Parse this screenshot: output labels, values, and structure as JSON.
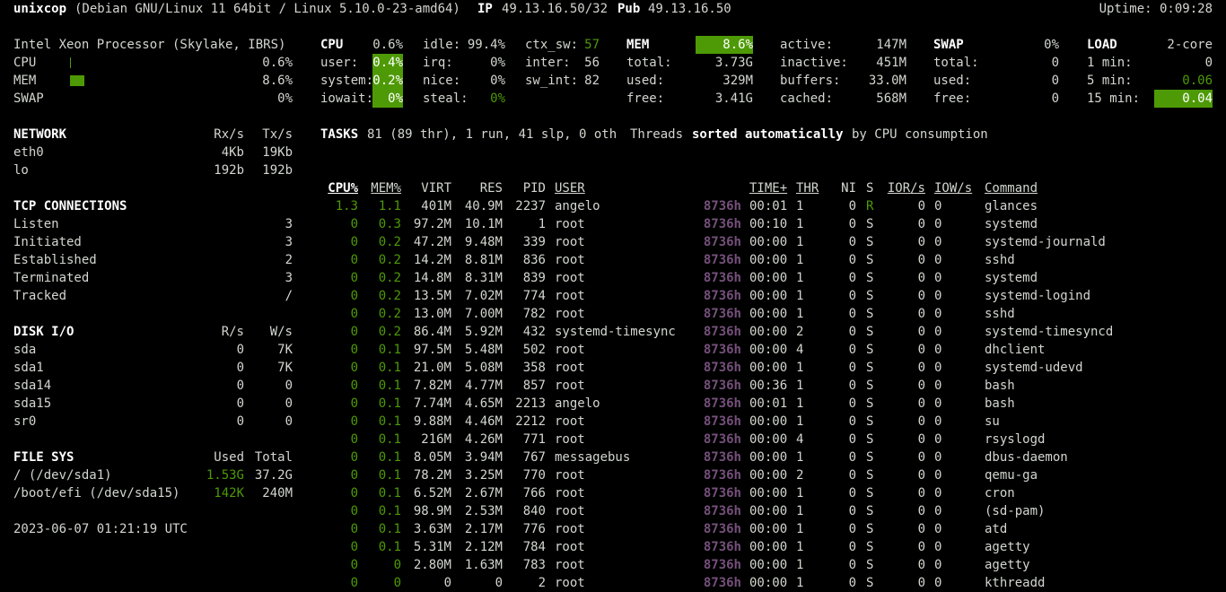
{
  "header": {
    "hostname": "unixcop",
    "os": "(Debian GNU/Linux 11 64bit / Linux 5.10.0-23-amd64)",
    "ip_label": "IP",
    "ip_value": "49.13.16.50/32",
    "pub_label": "Pub",
    "pub_value": "49.13.16.50",
    "uptime": "Uptime: 0:09:28"
  },
  "quicklook": {
    "cpu_name": "Intel Xeon Processor (Skylake, IBRS)",
    "rows": [
      {
        "label": "CPU",
        "value": "0.6%",
        "fraction": 0.006
      },
      {
        "label": "MEM",
        "value": "8.6%",
        "fraction": 0.086
      },
      {
        "label": "SWAP",
        "value": "0%",
        "fraction": 0
      }
    ]
  },
  "cpu": {
    "title": "CPU",
    "total": "0.6%",
    "col1": [
      {
        "l": "user:",
        "v": "0.4%"
      },
      {
        "l": "system:",
        "v": "0.2%"
      },
      {
        "l": "iowait:",
        "v": "0%"
      }
    ],
    "col2": [
      {
        "l": "idle:",
        "v": "99.4%"
      },
      {
        "l": "irq:",
        "v": "0%"
      },
      {
        "l": "nice:",
        "v": "0%"
      },
      {
        "l": "steal:",
        "v": "0%"
      }
    ],
    "col3": [
      {
        "l": "ctx_sw:",
        "v": "57"
      },
      {
        "l": "inter:",
        "v": "56"
      },
      {
        "l": "sw_int:",
        "v": "82"
      }
    ]
  },
  "mem": {
    "title": "MEM",
    "total": "8.6%",
    "col1": [
      {
        "l": "total:",
        "v": "3.73G"
      },
      {
        "l": "used:",
        "v": "329M"
      },
      {
        "l": "free:",
        "v": "3.41G"
      }
    ],
    "col2": [
      {
        "l": "active:",
        "v": "147M"
      },
      {
        "l": "inactive:",
        "v": "451M"
      },
      {
        "l": "buffers:",
        "v": "33.0M"
      },
      {
        "l": "cached:",
        "v": "568M"
      }
    ]
  },
  "swap": {
    "title": "SWAP",
    "total": "0%",
    "rows": [
      {
        "l": "total:",
        "v": "0"
      },
      {
        "l": "used:",
        "v": "0"
      },
      {
        "l": "free:",
        "v": "0"
      }
    ]
  },
  "load": {
    "title": "LOAD",
    "cores": "2-core",
    "rows": [
      {
        "l": "1 min:",
        "v": "0"
      },
      {
        "l": "5 min:",
        "v": "0.06"
      },
      {
        "l": "15 min:",
        "v": "0.04"
      }
    ]
  },
  "network": {
    "title": "NETWORK",
    "rx": "Rx/s",
    "tx": "Tx/s",
    "rows": [
      {
        "name": "eth0",
        "rx": "4Kb",
        "tx": "19Kb"
      },
      {
        "name": "lo",
        "rx": "192b",
        "tx": "192b"
      }
    ]
  },
  "tcp": {
    "title": "TCP CONNECTIONS",
    "rows": [
      {
        "l": "Listen",
        "v": "3"
      },
      {
        "l": "Initiated",
        "v": "3"
      },
      {
        "l": "Established",
        "v": "2"
      },
      {
        "l": "Terminated",
        "v": "3"
      },
      {
        "l": "Tracked",
        "v": "/"
      }
    ]
  },
  "disk": {
    "title": "DISK I/O",
    "r": "R/s",
    "w": "W/s",
    "rows": [
      {
        "name": "sda",
        "r": "0",
        "w": "7K"
      },
      {
        "name": "sda1",
        "r": "0",
        "w": "7K"
      },
      {
        "name": "sda14",
        "r": "0",
        "w": "0"
      },
      {
        "name": "sda15",
        "r": "0",
        "w": "0"
      },
      {
        "name": "sr0",
        "r": "0",
        "w": "0"
      }
    ]
  },
  "fs": {
    "title": "FILE SYS",
    "used": "Used",
    "total": "Total",
    "rows": [
      {
        "name": "/ (/dev/sda1)",
        "used": "1.53G",
        "total": "37.2G"
      },
      {
        "name": "/boot/efi (/dev/sda15)",
        "used": "142K",
        "total": "240M"
      }
    ]
  },
  "datetime": "2023-06-07 01:21:19 UTC",
  "tasks": {
    "title": "TASKS",
    "summary": "81 (89 thr), 1 run, 41 slp, 0 oth",
    "threads": "Threads",
    "sorted": "sorted automatically",
    "by": "by CPU consumption"
  },
  "proc_headers": {
    "cpu": "CPU%",
    "mem": "MEM%",
    "virt": "VIRT",
    "res": "RES",
    "pid": "PID",
    "user": "USER",
    "time": "TIME+",
    "thr": "THR",
    "ni": "NI",
    "s": "S",
    "ior": "IOR/s",
    "iow": "IOW/s",
    "cmd": "Command"
  },
  "processes": [
    {
      "cpu": "1.3",
      "mem": "1.1",
      "virt": "401M",
      "res": "40.9M",
      "pid": "2237",
      "user": "angelo",
      "h": "8736h",
      "time": "00:01",
      "thr": "1",
      "ni": "0",
      "s": "R",
      "ior": "0",
      "iow": "0",
      "cmd": "glances"
    },
    {
      "cpu": "0",
      "mem": "0.3",
      "virt": "97.2M",
      "res": "10.1M",
      "pid": "1",
      "user": "root",
      "h": "8736h",
      "time": "00:10",
      "thr": "1",
      "ni": "0",
      "s": "S",
      "ior": "0",
      "iow": "0",
      "cmd": "systemd"
    },
    {
      "cpu": "0",
      "mem": "0.2",
      "virt": "47.2M",
      "res": "9.48M",
      "pid": "339",
      "user": "root",
      "h": "8736h",
      "time": "00:00",
      "thr": "1",
      "ni": "0",
      "s": "S",
      "ior": "0",
      "iow": "0",
      "cmd": "systemd-journald"
    },
    {
      "cpu": "0",
      "mem": "0.2",
      "virt": "14.2M",
      "res": "8.81M",
      "pid": "836",
      "user": "root",
      "h": "8736h",
      "time": "00:00",
      "thr": "1",
      "ni": "0",
      "s": "S",
      "ior": "0",
      "iow": "0",
      "cmd": "sshd"
    },
    {
      "cpu": "0",
      "mem": "0.2",
      "virt": "14.8M",
      "res": "8.31M",
      "pid": "839",
      "user": "root",
      "h": "8736h",
      "time": "00:00",
      "thr": "1",
      "ni": "0",
      "s": "S",
      "ior": "0",
      "iow": "0",
      "cmd": "systemd"
    },
    {
      "cpu": "0",
      "mem": "0.2",
      "virt": "13.5M",
      "res": "7.02M",
      "pid": "774",
      "user": "root",
      "h": "8736h",
      "time": "00:00",
      "thr": "1",
      "ni": "0",
      "s": "S",
      "ior": "0",
      "iow": "0",
      "cmd": "systemd-logind"
    },
    {
      "cpu": "0",
      "mem": "0.2",
      "virt": "13.0M",
      "res": "7.00M",
      "pid": "782",
      "user": "root",
      "h": "8736h",
      "time": "00:00",
      "thr": "1",
      "ni": "0",
      "s": "S",
      "ior": "0",
      "iow": "0",
      "cmd": "sshd"
    },
    {
      "cpu": "0",
      "mem": "0.2",
      "virt": "86.4M",
      "res": "5.92M",
      "pid": "432",
      "user": "systemd-timesync",
      "h": "8736h",
      "time": "00:00",
      "thr": "2",
      "ni": "0",
      "s": "S",
      "ior": "0",
      "iow": "0",
      "cmd": "systemd-timesyncd"
    },
    {
      "cpu": "0",
      "mem": "0.1",
      "virt": "97.5M",
      "res": "5.48M",
      "pid": "502",
      "user": "root",
      "h": "8736h",
      "time": "00:00",
      "thr": "4",
      "ni": "0",
      "s": "S",
      "ior": "0",
      "iow": "0",
      "cmd": "dhclient"
    },
    {
      "cpu": "0",
      "mem": "0.1",
      "virt": "21.0M",
      "res": "5.08M",
      "pid": "358",
      "user": "root",
      "h": "8736h",
      "time": "00:00",
      "thr": "1",
      "ni": "0",
      "s": "S",
      "ior": "0",
      "iow": "0",
      "cmd": "systemd-udevd"
    },
    {
      "cpu": "0",
      "mem": "0.1",
      "virt": "7.82M",
      "res": "4.77M",
      "pid": "857",
      "user": "root",
      "h": "8736h",
      "time": "00:36",
      "thr": "1",
      "ni": "0",
      "s": "S",
      "ior": "0",
      "iow": "0",
      "cmd": "bash"
    },
    {
      "cpu": "0",
      "mem": "0.1",
      "virt": "7.74M",
      "res": "4.65M",
      "pid": "2213",
      "user": "angelo",
      "h": "8736h",
      "time": "00:01",
      "thr": "1",
      "ni": "0",
      "s": "S",
      "ior": "0",
      "iow": "0",
      "cmd": "bash"
    },
    {
      "cpu": "0",
      "mem": "0.1",
      "virt": "9.88M",
      "res": "4.46M",
      "pid": "2212",
      "user": "root",
      "h": "8736h",
      "time": "00:00",
      "thr": "1",
      "ni": "0",
      "s": "S",
      "ior": "0",
      "iow": "0",
      "cmd": "su"
    },
    {
      "cpu": "0",
      "mem": "0.1",
      "virt": "216M",
      "res": "4.26M",
      "pid": "771",
      "user": "root",
      "h": "8736h",
      "time": "00:00",
      "thr": "4",
      "ni": "0",
      "s": "S",
      "ior": "0",
      "iow": "0",
      "cmd": "rsyslogd"
    },
    {
      "cpu": "0",
      "mem": "0.1",
      "virt": "8.05M",
      "res": "3.94M",
      "pid": "767",
      "user": "messagebus",
      "h": "8736h",
      "time": "00:00",
      "thr": "1",
      "ni": "0",
      "s": "S",
      "ior": "0",
      "iow": "0",
      "cmd": "dbus-daemon"
    },
    {
      "cpu": "0",
      "mem": "0.1",
      "virt": "78.2M",
      "res": "3.25M",
      "pid": "770",
      "user": "root",
      "h": "8736h",
      "time": "00:00",
      "thr": "2",
      "ni": "0",
      "s": "S",
      "ior": "0",
      "iow": "0",
      "cmd": "qemu-ga"
    },
    {
      "cpu": "0",
      "mem": "0.1",
      "virt": "6.52M",
      "res": "2.67M",
      "pid": "766",
      "user": "root",
      "h": "8736h",
      "time": "00:00",
      "thr": "1",
      "ni": "0",
      "s": "S",
      "ior": "0",
      "iow": "0",
      "cmd": "cron"
    },
    {
      "cpu": "0",
      "mem": "0.1",
      "virt": "98.9M",
      "res": "2.53M",
      "pid": "840",
      "user": "root",
      "h": "8736h",
      "time": "00:00",
      "thr": "1",
      "ni": "0",
      "s": "S",
      "ior": "0",
      "iow": "0",
      "cmd": "(sd-pam)"
    },
    {
      "cpu": "0",
      "mem": "0.1",
      "virt": "3.63M",
      "res": "2.17M",
      "pid": "776",
      "user": "root",
      "h": "8736h",
      "time": "00:00",
      "thr": "1",
      "ni": "0",
      "s": "S",
      "ior": "0",
      "iow": "0",
      "cmd": "atd"
    },
    {
      "cpu": "0",
      "mem": "0.1",
      "virt": "5.31M",
      "res": "2.12M",
      "pid": "784",
      "user": "root",
      "h": "8736h",
      "time": "00:00",
      "thr": "1",
      "ni": "0",
      "s": "S",
      "ior": "0",
      "iow": "0",
      "cmd": "agetty"
    },
    {
      "cpu": "0",
      "mem": "0",
      "virt": "2.80M",
      "res": "1.63M",
      "pid": "783",
      "user": "root",
      "h": "8736h",
      "time": "00:00",
      "thr": "1",
      "ni": "0",
      "s": "S",
      "ior": "0",
      "iow": "0",
      "cmd": "agetty"
    },
    {
      "cpu": "0",
      "mem": "0",
      "virt": "0",
      "res": "0",
      "pid": "2",
      "user": "root",
      "h": "8736h",
      "time": "00:00",
      "thr": "1",
      "ni": "0",
      "s": "S",
      "ior": "0",
      "iow": "0",
      "cmd": "kthreadd"
    }
  ]
}
